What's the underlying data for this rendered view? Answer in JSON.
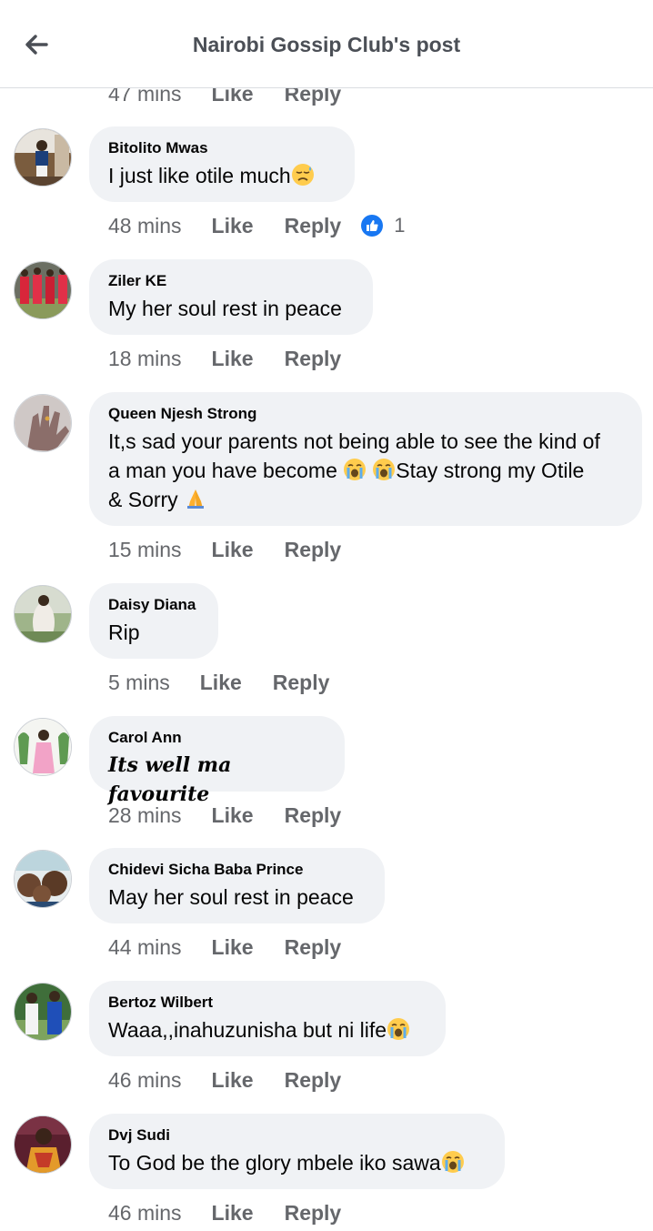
{
  "header": {
    "title": "Nairobi Gossip Club's post"
  },
  "partial": {
    "time": "47 mins",
    "like": "Like",
    "reply": "Reply"
  },
  "comments": [
    {
      "author": "Bitolito Mwas",
      "text": "I just like otile much",
      "emoji_after": "sad-face-emoji",
      "time": "48 mins",
      "like": "Like",
      "reply": "Reply",
      "reactions": "1"
    },
    {
      "author": "Ziler KE",
      "text": "My her soul rest in peace",
      "time": "18 mins",
      "like": "Like",
      "reply": "Reply"
    },
    {
      "author": "Queen Njesh Strong",
      "line1": "It,s sad your parents not being able to see the kind of",
      "line2a": "a man you have become ",
      "line2b": "Stay strong my Otile",
      "line3": "& Sorry ",
      "time": "15 mins",
      "like": "Like",
      "reply": "Reply"
    },
    {
      "author": "Daisy Diana",
      "text": "Rip",
      "time": "5 mins",
      "like": "Like",
      "reply": "Reply"
    },
    {
      "author": "Carol Ann",
      "text": "Its well ma favourite",
      "time": "28 mins",
      "like": "Like",
      "reply": "Reply"
    },
    {
      "author": "Chidevi Sicha Baba Prince",
      "text": "May her soul rest in peace",
      "time": "44 mins",
      "like": "Like",
      "reply": "Reply"
    },
    {
      "author": "Bertoz Wilbert",
      "text": "Waaa,,inahuzunisha but ni life",
      "time": "46 mins",
      "like": "Like",
      "reply": "Reply"
    },
    {
      "author": "Dvj Sudi",
      "text": "To God be the glory mbele iko sawa",
      "time": "46 mins",
      "like": "Like",
      "reply": "Reply"
    }
  ],
  "colors": {
    "bubble": "#f0f2f5",
    "meta": "#65676b",
    "like_blue": "#1877f2",
    "title": "#4b4f56"
  }
}
